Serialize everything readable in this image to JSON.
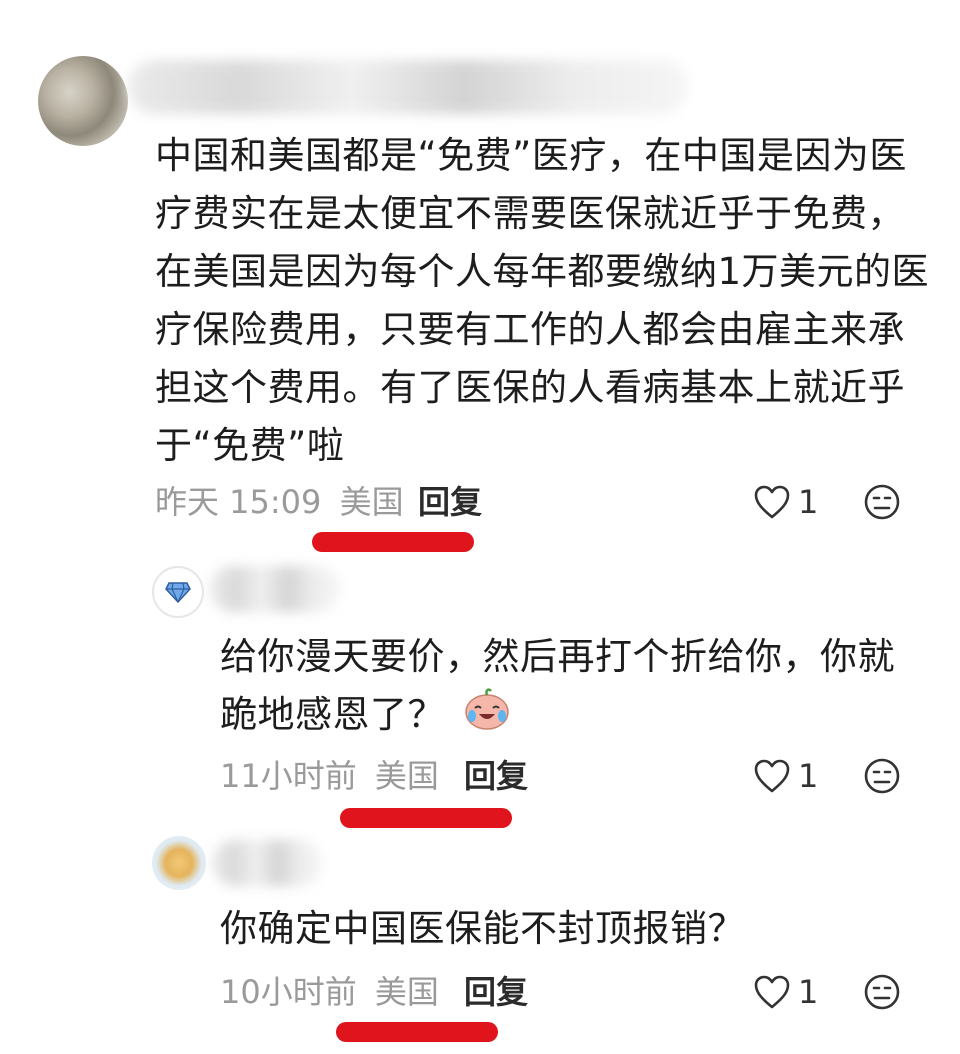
{
  "comments": [
    {
      "text": "中国和美国都是“免费”医疗，在中国是因为医疗费实在是太便宜不需要医保就近乎于免费，在美国是因为每个人每年都要缴纳1万美元的医疗保险费用，只要有工作的人都会由雇主来承担这个费用。有了医保的人看病基本上就近乎于“免费”啦",
      "lines": [
        "中国和美国都是“免费”医疗，在中国是因为医",
        "疗费实在是太便宜不需要医保就近乎于免费，",
        "在美国是因为每个人每年都要缴纳1万美元的医",
        "疗保险费用，只要有工作的人都会由雇主来承",
        "担这个费用。有了医保的人看病基本上就近乎",
        "于“免费”啦"
      ],
      "time": "昨天 15:09",
      "location": "美国",
      "reply_label": "回复",
      "likes": "1"
    },
    {
      "lines": [
        "给你漫天要价，然后再打个折给你，你就",
        "跪地感恩了？"
      ],
      "emoji": "crying-laughing-emoji",
      "time": "11小时前",
      "location": "美国",
      "reply_label": "回复",
      "likes": "1"
    },
    {
      "lines": [
        "你确定中国医保能不封顶报销？"
      ],
      "time": "10小时前",
      "location": "美国",
      "reply_label": "回复",
      "likes": "1"
    }
  ],
  "colors": {
    "annotation_red": "#e0141c",
    "meta_gray": "#9a9a9a"
  }
}
